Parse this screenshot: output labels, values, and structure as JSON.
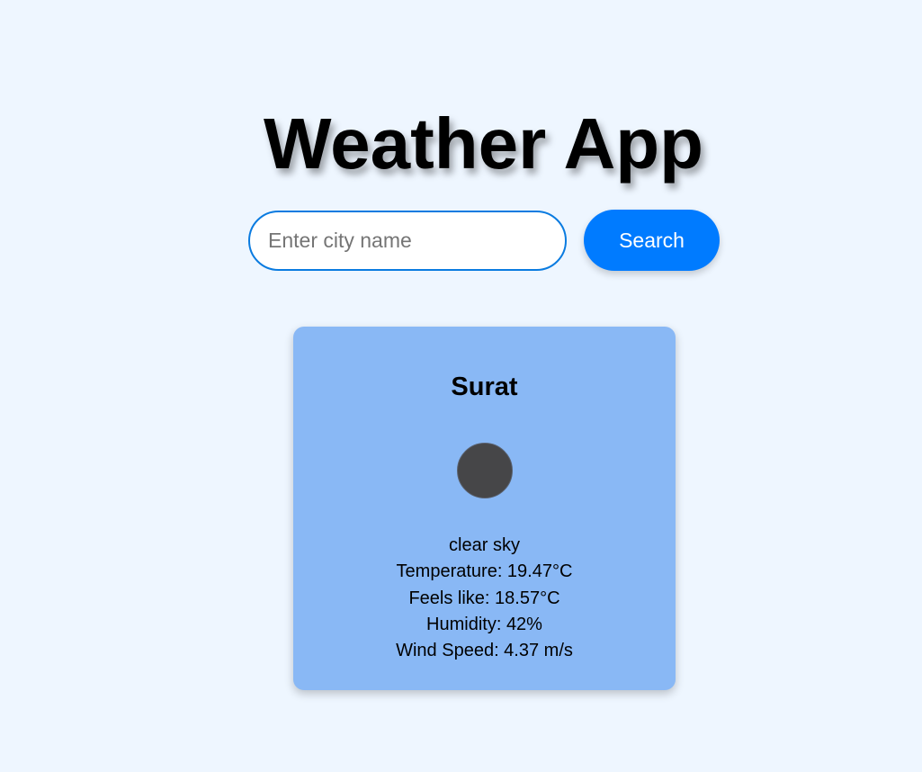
{
  "header": {
    "title": "Weather App"
  },
  "search": {
    "placeholder": "Enter city name",
    "value": "",
    "button_label": "Search"
  },
  "weather": {
    "city": "Surat",
    "icon": "weather-icon",
    "description": "clear sky",
    "temperature": "Temperature: 19.47°C",
    "feels_like": "Feels like: 18.57°C",
    "humidity": "Humidity: 42%",
    "wind_speed": "Wind Speed: 4.37 m/s"
  },
  "colors": {
    "background": "#eef6ff",
    "accent": "#007bff",
    "card": "#89b8f5"
  }
}
